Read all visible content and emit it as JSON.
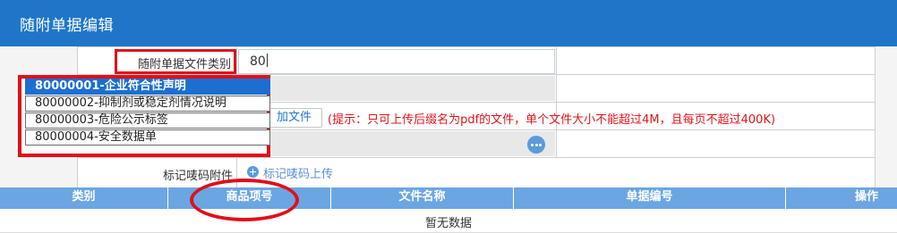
{
  "window": {
    "title": "随附单据编辑"
  },
  "form": {
    "doc_type_label": "随附单据文件类别",
    "doc_type_value": "80",
    "mark_attachment_label": "标记唛码附件",
    "upload_button_label": "加文件",
    "upload_hint": "(提示：只可上传后缀名为pdf的文件，单个文件大小不能超过4M，且每页不超过400K)",
    "mark_upload_link": "标记唛码上传"
  },
  "dropdown": {
    "options": [
      "80000001-企业符合性声明",
      "80000002-抑制剂或稳定剂情况说明",
      "80000003-危险公示标签",
      "80000004-安全数据单"
    ],
    "selected_index": 0
  },
  "table": {
    "columns": [
      "类别",
      "商品项号",
      "文件名称",
      "单据编号",
      "操作"
    ],
    "empty_text": "暂无数据"
  },
  "colors": {
    "title_bar": "#1f76c9",
    "table_header": "#6ba6e3",
    "annotation_red": "#e0101a",
    "hint_red": "#e0141a"
  },
  "icons": {
    "lookup": "more-dots-icon",
    "upload": "plus-circle-icon"
  }
}
